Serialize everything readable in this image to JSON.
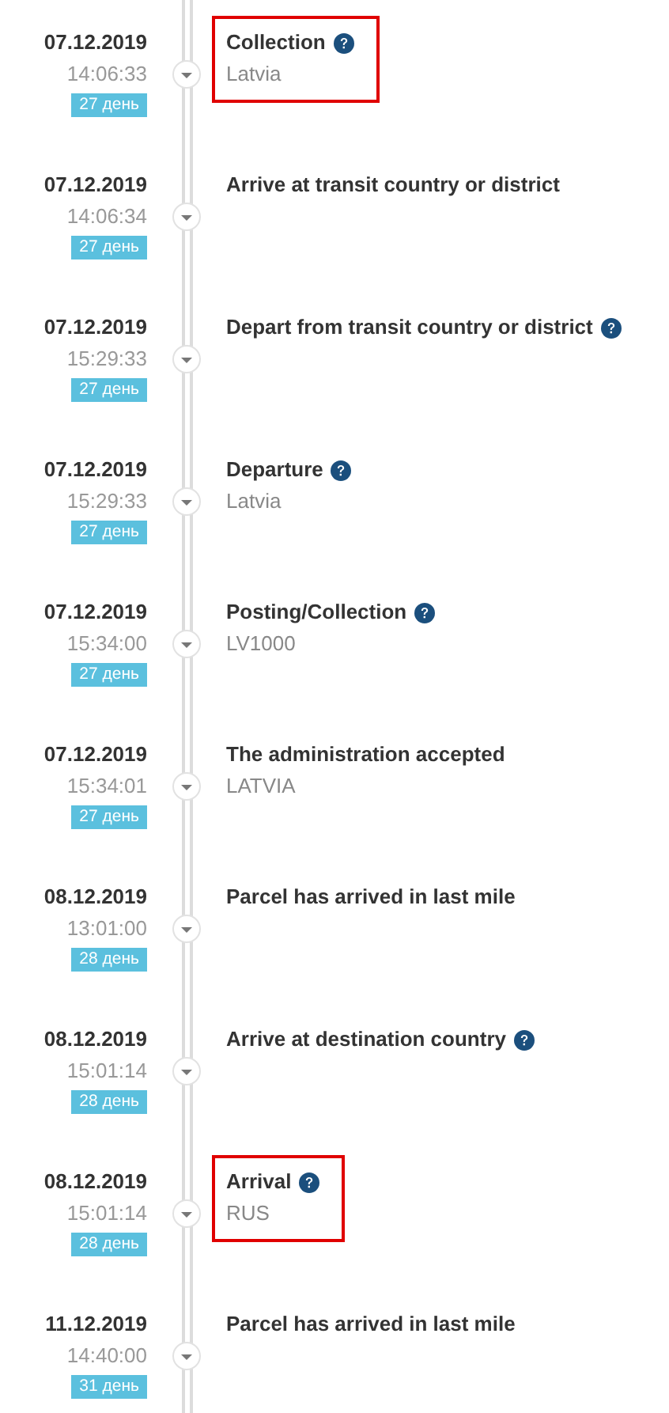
{
  "events": [
    {
      "date": "07.12.2019",
      "time": "14:06:33",
      "day_badge": "27 день",
      "title": "Collection",
      "help": true,
      "description": "Latvia",
      "highlighted": true
    },
    {
      "date": "07.12.2019",
      "time": "14:06:34",
      "day_badge": "27 день",
      "title": "Arrive at transit country or district",
      "help": false,
      "highlighted": false
    },
    {
      "date": "07.12.2019",
      "time": "15:29:33",
      "day_badge": "27 день",
      "title": "Depart from transit country or district",
      "help": true,
      "highlighted": false
    },
    {
      "date": "07.12.2019",
      "time": "15:29:33",
      "day_badge": "27 день",
      "title": "Departure",
      "help": true,
      "description": "Latvia",
      "highlighted": false
    },
    {
      "date": "07.12.2019",
      "time": "15:34:00",
      "day_badge": "27 день",
      "title": "Posting/Collection",
      "help": true,
      "description": "LV1000",
      "highlighted": false
    },
    {
      "date": "07.12.2019",
      "time": "15:34:01",
      "day_badge": "27 день",
      "title": "The administration accepted",
      "help": false,
      "description": "LATVIA",
      "highlighted": false
    },
    {
      "date": "08.12.2019",
      "time": "13:01:00",
      "day_badge": "28 день",
      "title": "Parcel has arrived in last mile",
      "help": false,
      "highlighted": false
    },
    {
      "date": "08.12.2019",
      "time": "15:01:14",
      "day_badge": "28 день",
      "title": "Arrive at destination country",
      "help": true,
      "highlighted": false
    },
    {
      "date": "08.12.2019",
      "time": "15:01:14",
      "day_badge": "28 день",
      "title": "Arrival",
      "help": true,
      "description": "RUS",
      "highlighted": true
    },
    {
      "date": "11.12.2019",
      "time": "14:40:00",
      "day_badge": "31 день",
      "title": "Parcel has arrived in last mile",
      "help": false,
      "highlighted": false
    }
  ]
}
